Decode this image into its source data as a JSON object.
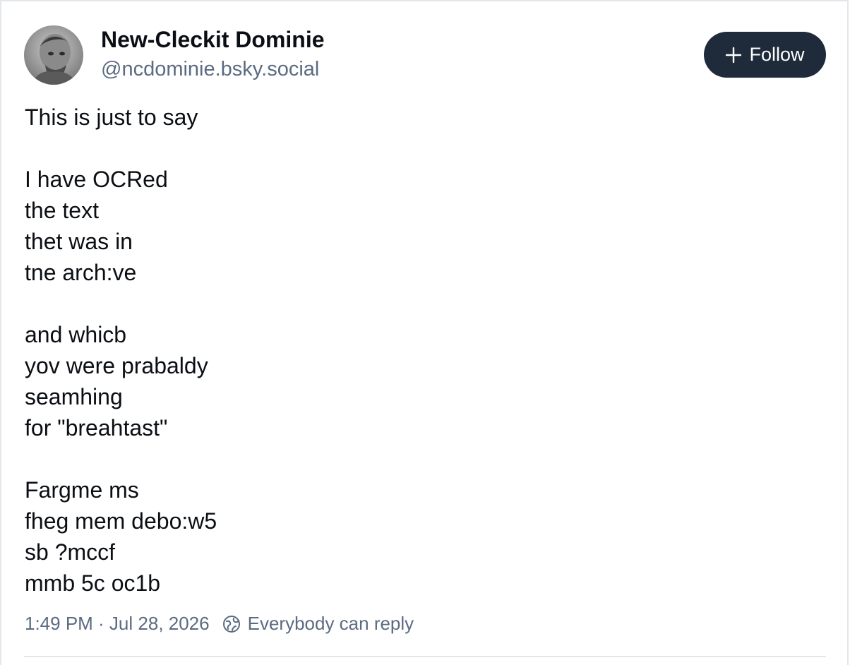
{
  "author": {
    "display_name": "New-Cleckit Dominie",
    "handle": "@ncdominie.bsky.social",
    "avatar_icon": "avatar-portrait"
  },
  "follow_button": {
    "label": "Follow",
    "icon": "plus-icon",
    "background": "#1f2b3b"
  },
  "post": {
    "lines": [
      "This is just to say",
      "",
      "I have OCRed",
      "the text",
      "thet was in",
      "tne arch:ve",
      "",
      "and whicb",
      "yov were prabaldy",
      "seamhing",
      "for \"breahtast\"",
      "",
      "Fargme ms",
      "fheg mem debo:w5",
      "sb ?mccf",
      "mmb 5c oc1b"
    ]
  },
  "meta": {
    "timestamp": "1:49 PM · Jul 28, 2026",
    "reply_setting": "Everybody can reply",
    "reply_icon": "globe-icon"
  },
  "colors": {
    "text": "#0b0f14",
    "muted": "#5b6b80",
    "border": "#e3e7ec"
  }
}
